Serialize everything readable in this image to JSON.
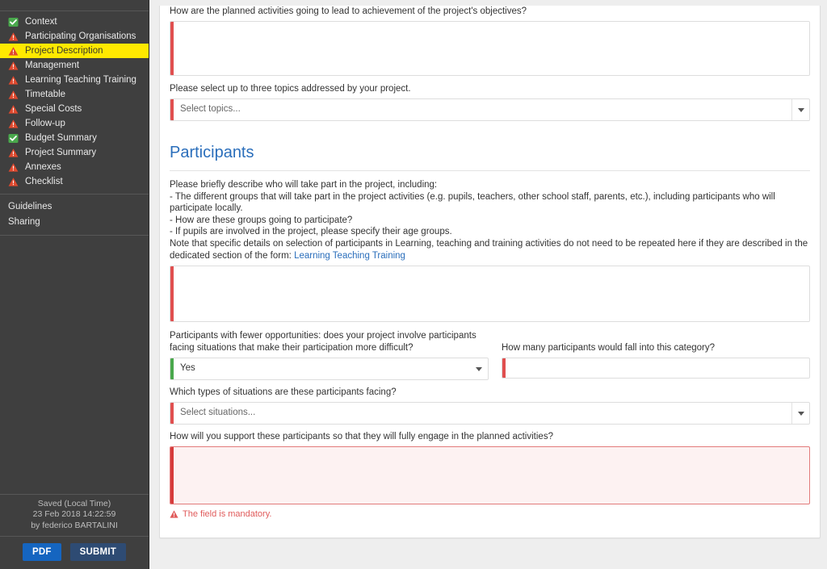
{
  "sidebar": {
    "nav_items": [
      {
        "label": "Context",
        "status": "ok",
        "active": false
      },
      {
        "label": "Participating Organisations",
        "status": "warn",
        "active": false
      },
      {
        "label": "Project Description",
        "status": "warn",
        "active": true
      },
      {
        "label": "Management",
        "status": "warn",
        "active": false
      },
      {
        "label": "Learning Teaching Training",
        "status": "warn",
        "active": false
      },
      {
        "label": "Timetable",
        "status": "warn",
        "active": false
      },
      {
        "label": "Special Costs",
        "status": "warn",
        "active": false
      },
      {
        "label": "Follow-up",
        "status": "warn",
        "active": false
      },
      {
        "label": "Budget Summary",
        "status": "ok",
        "active": false
      },
      {
        "label": "Project Summary",
        "status": "warn",
        "active": false
      },
      {
        "label": "Annexes",
        "status": "warn",
        "active": false
      },
      {
        "label": "Checklist",
        "status": "warn",
        "active": false
      }
    ],
    "links": [
      {
        "label": "Guidelines"
      },
      {
        "label": "Sharing"
      }
    ],
    "saved": {
      "line1": "Saved (Local Time)",
      "line2": "23 Feb 2018 14:22:59",
      "line3": "by federico BARTALINI"
    },
    "buttons": {
      "pdf": "PDF",
      "submit": "SUBMIT"
    },
    "colors": {
      "background": "#3f3f3f",
      "active_highlight": "#ffe900",
      "ok_icon": "#49a84c",
      "warn_icon": "#e0492e",
      "pdf_button": "#1565c0",
      "submit_button": "#2e4b73"
    }
  },
  "main": {
    "q_objectives": {
      "label": "How are the planned activities going to lead to achievement of the project's objectives?",
      "value": ""
    },
    "q_topics": {
      "label": "Please select up to three topics addressed by your project.",
      "placeholder": "Select topics...",
      "value": ""
    },
    "participants_section": {
      "heading": "Participants",
      "description_lines": [
        "Please briefly describe who will take part in the project, including:",
        "-  The different groups that will take part in the project activities (e.g. pupils, teachers, other school staff, parents, etc.), including participants who will participate locally.",
        "-  How are these groups going to participate?",
        "-  If pupils are involved in the project, please specify their age groups."
      ],
      "note_prefix": "Note that specific details on selection of participants in Learning, teaching and training activities do not need to be repeated here if they are described in the dedicated section of the form: ",
      "note_link": "Learning Teaching Training",
      "describe_value": ""
    },
    "q_fewer_opportunities": {
      "label": "Participants with fewer opportunities: does your project involve participants facing situations that make their participation more difficult?",
      "value": "Yes"
    },
    "q_how_many": {
      "label": "How many participants would fall into this category?",
      "value": ""
    },
    "q_situations": {
      "label": "Which types of situations are these participants facing?",
      "placeholder": "Select situations...",
      "value": ""
    },
    "q_support": {
      "label": "How will you support these participants so that they will fully engage in the planned activities?",
      "value": "",
      "error": "The field is mandatory."
    },
    "colors": {
      "heading": "#2a6ebb",
      "mandatory_bar": "#e04f4f",
      "valid_bar": "#49a84c",
      "error_text": "#e05b5b",
      "error_bg": "#fdf2f2",
      "link": "#2a6ebb"
    }
  }
}
